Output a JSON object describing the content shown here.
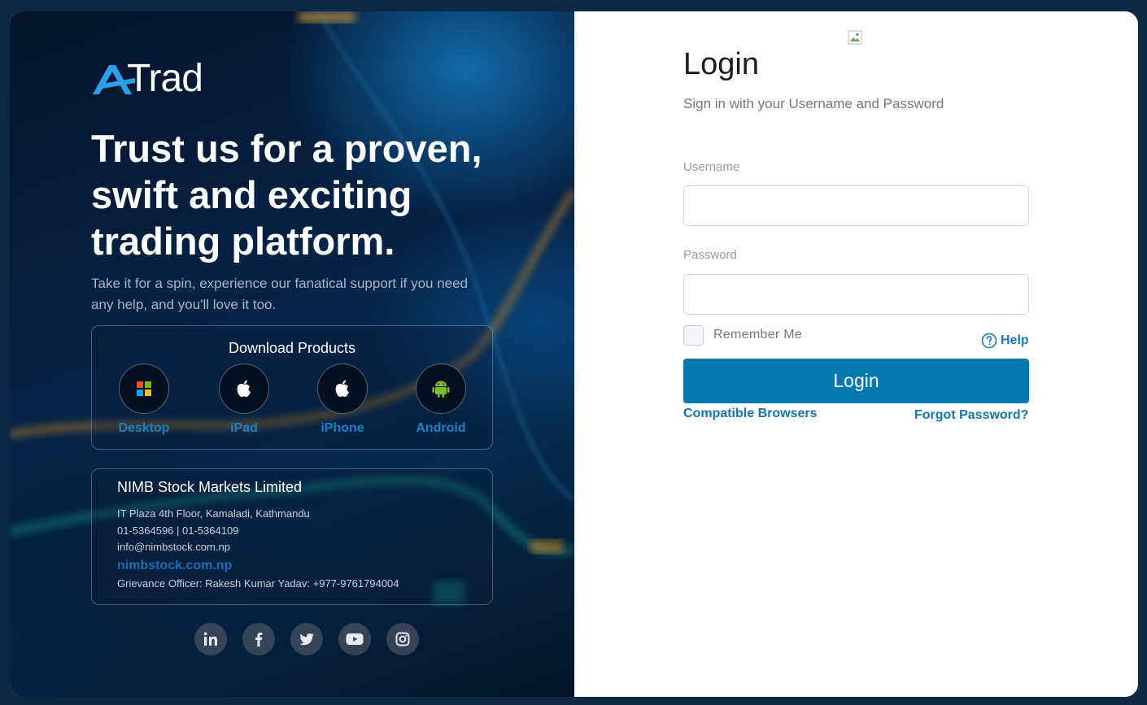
{
  "brand": {
    "logo_text": "Trad"
  },
  "hero": {
    "headline": "Trust us for a proven, swift and exciting trading platform.",
    "subtext": "Take it for a spin, experience our fanatical support if you need any help, and you'll love it too."
  },
  "download": {
    "title": "Download Products",
    "items": [
      {
        "label": "Desktop",
        "icon": "windows-icon"
      },
      {
        "label": "iPad",
        "icon": "apple-icon"
      },
      {
        "label": "iPhone",
        "icon": "apple-icon"
      },
      {
        "label": "Android",
        "icon": "android-icon"
      }
    ]
  },
  "contact": {
    "company": "NIMB Stock Markets Limited",
    "address": "IT Plaza 4th Floor, Kamaladi, Kathmandu",
    "phone": "01-5364596 | 01-5364109",
    "email": "info@nimbstock.com.np",
    "website": "nimbstock.com.np",
    "grievance": "Grievance Officer: Rakesh Kumar Yadav: +977-9761794004"
  },
  "socials": [
    "linkedin-icon",
    "facebook-icon",
    "twitter-icon",
    "youtube-icon",
    "instagram-icon"
  ],
  "login": {
    "title": "Login",
    "subtitle": "Sign in with your Username and Password",
    "username_label": "Username",
    "username_value": "",
    "password_label": "Password",
    "password_value": "",
    "remember_label": "Remember Me",
    "help_label": "Help",
    "button_label": "Login",
    "compatible_label": "Compatible Browsers",
    "forgot_label": "Forgot Password?"
  },
  "colors": {
    "accent": "#0679b0",
    "link": "#1574ad",
    "product_label": "#1f7fc4",
    "page_bg": "#0d2747"
  }
}
